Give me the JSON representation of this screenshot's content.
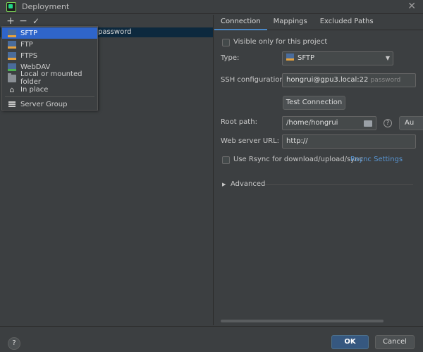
{
  "window": {
    "title": "Deployment",
    "close_glyph": "✕"
  },
  "toolbar": {
    "add": "+",
    "remove": "−",
    "apply": "✓"
  },
  "server_list": {
    "row_text": "password"
  },
  "add_menu": {
    "items": [
      {
        "label": "SFTP",
        "icon": "sftp-icon",
        "selected": true
      },
      {
        "label": "FTP",
        "icon": "ftp-icon"
      },
      {
        "label": "FTPS",
        "icon": "ftps-icon"
      },
      {
        "label": "WebDAV",
        "icon": "webdav-icon"
      },
      {
        "label": "Local or mounted folder",
        "icon": "folder-icon"
      },
      {
        "label": "In place",
        "icon": "home-icon"
      }
    ],
    "group_item": {
      "label": "Server Group",
      "icon": "server-group-icon"
    }
  },
  "tabs": [
    {
      "label": "Connection",
      "active": true
    },
    {
      "label": "Mappings"
    },
    {
      "label": "Excluded Paths"
    }
  ],
  "connection": {
    "visible_only_label": "Visible only for this project",
    "type_label": "Type:",
    "type_value": "SFTP",
    "ssh_label": "SSH configuration:",
    "ssh_value": "hongrui@gpu3.local:22",
    "ssh_hint": "password",
    "test_connection": "Test Connection",
    "root_path_label": "Root path:",
    "root_path_value": "/home/hongrui",
    "help_glyph": "?",
    "autodetect_label": "Au",
    "web_url_label": "Web server URL:",
    "web_url_value": "http://",
    "rsync_label": "Use Rsync for download/upload/sync",
    "rsync_settings": "Rsync Settings",
    "advanced_label": "Advanced"
  },
  "footer": {
    "help": "?",
    "ok": "OK",
    "cancel": "Cancel"
  },
  "colors": {
    "accent": "#2f65ca",
    "link": "#5896d4",
    "ok": "#365880",
    "background": "#3c3f41"
  }
}
